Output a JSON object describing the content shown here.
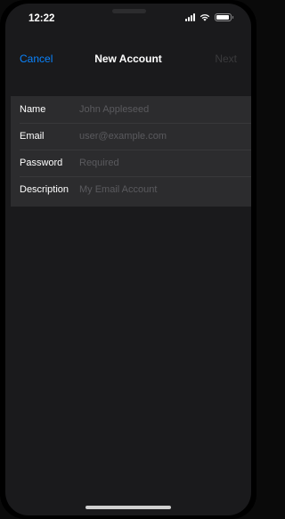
{
  "status_bar": {
    "time": "12:22",
    "signal_icon": "signal-icon",
    "wifi_icon": "wifi-icon",
    "battery_icon": "battery-icon"
  },
  "nav": {
    "cancel_label": "Cancel",
    "title": "New Account",
    "next_label": "Next"
  },
  "form": {
    "fields": [
      {
        "label": "Name",
        "value": "",
        "placeholder": "John Appleseed"
      },
      {
        "label": "Email",
        "value": "",
        "placeholder": "user@example.com"
      },
      {
        "label": "Password",
        "value": "",
        "placeholder": "Required"
      },
      {
        "label": "Description",
        "value": "",
        "placeholder": "My Email Account"
      }
    ]
  },
  "colors": {
    "accent": "#0a84ff",
    "background": "#1a1a1c",
    "card": "#2c2c2e",
    "disabled": "#3a3a3c",
    "placeholder": "#5a5a5e"
  }
}
